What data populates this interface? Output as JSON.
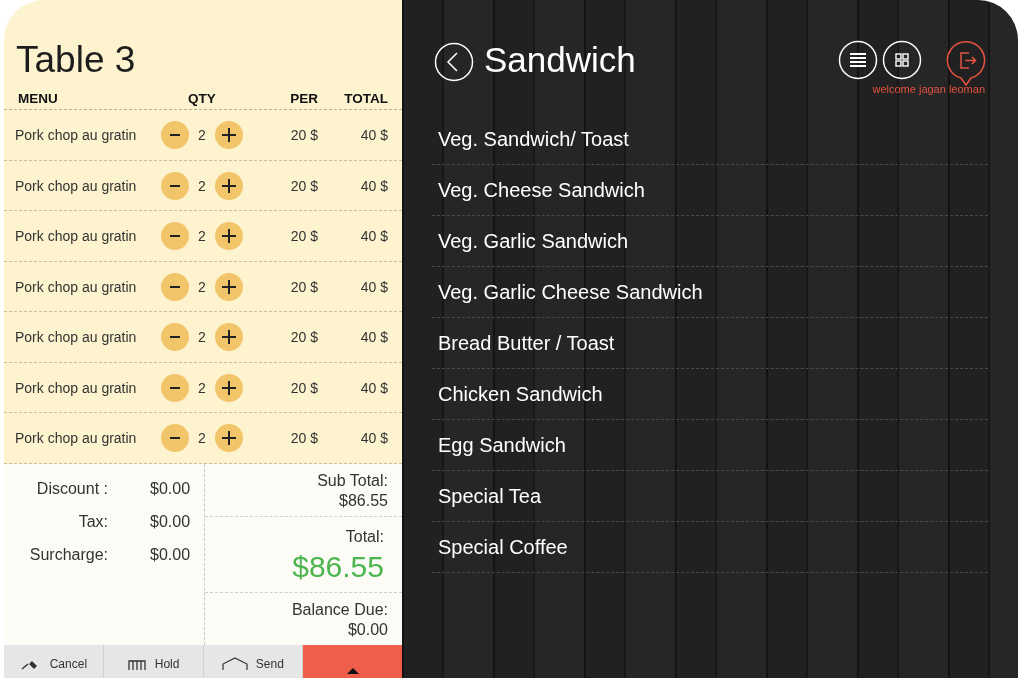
{
  "order": {
    "title": "Table 3",
    "columns": [
      "MENU",
      "QTY",
      "PER",
      "TOTAL"
    ],
    "rows": [
      {
        "item": "Pork chop au gratin",
        "qty": "2",
        "per": "20 $",
        "total": "40 $"
      },
      {
        "item": "Pork chop au gratin",
        "qty": "2",
        "per": "20 $",
        "total": "40 $"
      },
      {
        "item": "Pork chop au gratin",
        "qty": "2",
        "per": "20 $",
        "total": "40 $"
      },
      {
        "item": "Pork chop au gratin",
        "qty": "2",
        "per": "20 $",
        "total": "40 $"
      },
      {
        "item": "Pork chop au gratin",
        "qty": "2",
        "per": "20 $",
        "total": "40 $"
      },
      {
        "item": "Pork chop au gratin",
        "qty": "2",
        "per": "20 $",
        "total": "40 $"
      },
      {
        "item": "Pork chop au gratin",
        "qty": "2",
        "per": "20 $",
        "total": "40 $"
      }
    ]
  },
  "summary": {
    "adjustments": [
      {
        "label": "Discount :",
        "value": "$0.00"
      },
      {
        "label": "Tax:",
        "value": "$0.00"
      },
      {
        "label": "Surcharge:",
        "value": "$0.00"
      }
    ],
    "sub_total": {
      "label": "Sub Total:",
      "value": "$86.55"
    },
    "total": {
      "label": "Total:",
      "value": "$86.55"
    },
    "balance_due": {
      "label": "Balance Due:",
      "value": "$0.00"
    }
  },
  "actions": [
    {
      "kind": "cancel",
      "label": "Cancel"
    },
    {
      "kind": "hold",
      "label": "Hold"
    },
    {
      "kind": "send",
      "label": "Send"
    },
    {
      "kind": "pay"
    }
  ],
  "category": {
    "title": "Sandwich",
    "items": [
      "Veg. Sandwich/ Toast",
      "Veg. Cheese Sandwich",
      "Veg. Garlic Sandwich",
      "Veg. Garlic Cheese Sandwich",
      "Bread Butter / Toast",
      "Chicken Sandwich",
      "Egg Sandwich",
      "Special Tea",
      "Special Coffee"
    ]
  },
  "user": {
    "welcome": "welcome jagan leoman"
  }
}
